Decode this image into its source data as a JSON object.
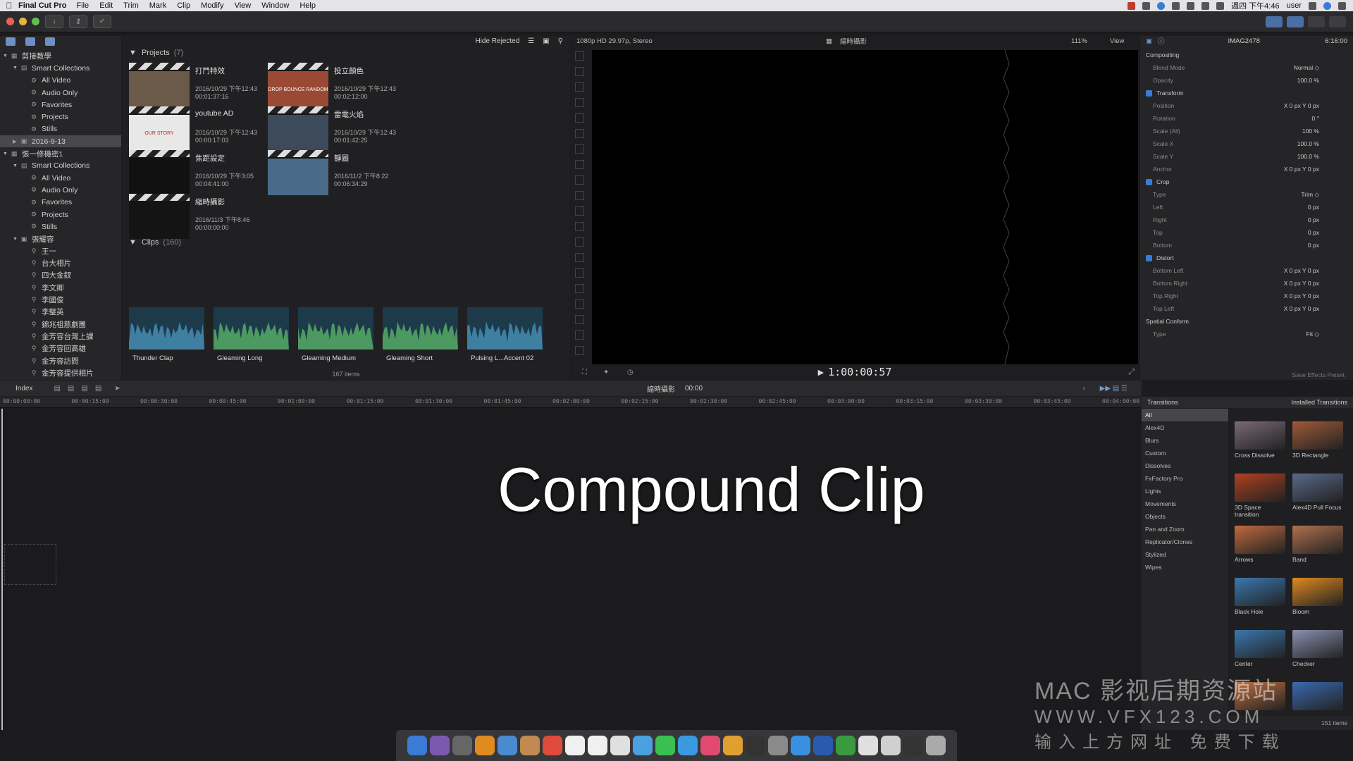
{
  "menubar": {
    "app_name": "Final Cut Pro",
    "items": [
      "File",
      "Edit",
      "Trim",
      "Mark",
      "Clip",
      "Modify",
      "View",
      "Window",
      "Help"
    ],
    "clock": "週四 下午4:46",
    "user": "user"
  },
  "library": {
    "rows": [
      {
        "label": "剪接教學",
        "indent": 0,
        "tri": "▼",
        "icon": "library-icon",
        "glyph": "▦"
      },
      {
        "label": "Smart Collections",
        "indent": 1,
        "tri": "▼",
        "icon": "folder-icon",
        "glyph": "▤"
      },
      {
        "label": "All Video",
        "indent": 2,
        "tri": "",
        "icon": "gear-icon",
        "glyph": "⚙"
      },
      {
        "label": "Audio Only",
        "indent": 2,
        "tri": "",
        "icon": "gear-icon",
        "glyph": "⚙"
      },
      {
        "label": "Favorites",
        "indent": 2,
        "tri": "",
        "icon": "gear-icon",
        "glyph": "⚙"
      },
      {
        "label": "Projects",
        "indent": 2,
        "tri": "",
        "icon": "gear-icon",
        "glyph": "⚙"
      },
      {
        "label": "Stills",
        "indent": 2,
        "tri": "",
        "icon": "gear-icon",
        "glyph": "⚙"
      },
      {
        "label": "2016-9-13",
        "indent": 1,
        "tri": "▶",
        "icon": "event-icon",
        "glyph": "▣",
        "selected": true
      },
      {
        "label": "張一修機密1",
        "indent": 0,
        "tri": "▼",
        "icon": "library-icon",
        "glyph": "▦"
      },
      {
        "label": "Smart Collections",
        "indent": 1,
        "tri": "▼",
        "icon": "folder-icon",
        "glyph": "▤"
      },
      {
        "label": "All Video",
        "indent": 2,
        "tri": "",
        "icon": "gear-icon",
        "glyph": "⚙"
      },
      {
        "label": "Audio Only",
        "indent": 2,
        "tri": "",
        "icon": "gear-icon",
        "glyph": "⚙"
      },
      {
        "label": "Favorites",
        "indent": 2,
        "tri": "",
        "icon": "gear-icon",
        "glyph": "⚙"
      },
      {
        "label": "Projects",
        "indent": 2,
        "tri": "",
        "icon": "gear-icon",
        "glyph": "⚙"
      },
      {
        "label": "Stills",
        "indent": 2,
        "tri": "",
        "icon": "gear-icon",
        "glyph": "⚙"
      },
      {
        "label": "張耀容",
        "indent": 1,
        "tri": "▼",
        "icon": "event-icon",
        "glyph": "▣"
      },
      {
        "label": "王一",
        "indent": 2,
        "tri": "",
        "icon": "keyword-icon",
        "glyph": "⚲"
      },
      {
        "label": "台大相片",
        "indent": 2,
        "tri": "",
        "icon": "keyword-icon",
        "glyph": "⚲"
      },
      {
        "label": "四大金釵",
        "indent": 2,
        "tri": "",
        "icon": "keyword-icon",
        "glyph": "⚲"
      },
      {
        "label": "李文卿",
        "indent": 2,
        "tri": "",
        "icon": "keyword-icon",
        "glyph": "⚲"
      },
      {
        "label": "李國俊",
        "indent": 2,
        "tri": "",
        "icon": "keyword-icon",
        "glyph": "⚲"
      },
      {
        "label": "李璧英",
        "indent": 2,
        "tri": "",
        "icon": "keyword-icon",
        "glyph": "⚲"
      },
      {
        "label": "錦兆祖慈劇團",
        "indent": 2,
        "tri": "",
        "icon": "keyword-icon",
        "glyph": "⚲"
      },
      {
        "label": "金芳容台灣上課",
        "indent": 2,
        "tri": "",
        "icon": "keyword-icon",
        "glyph": "⚲"
      },
      {
        "label": "金芳容回高雄",
        "indent": 2,
        "tri": "",
        "icon": "keyword-icon",
        "glyph": "⚲"
      },
      {
        "label": "金芳容訪問",
        "indent": 2,
        "tri": "",
        "icon": "keyword-icon",
        "glyph": "⚲"
      },
      {
        "label": "金芳容提供相片",
        "indent": 2,
        "tri": "",
        "icon": "keyword-icon",
        "glyph": "⚲"
      }
    ]
  },
  "browser": {
    "filter": "Hide Rejected",
    "projects_label": "Projects",
    "projects_count": "(7)",
    "projects": [
      {
        "name": "打鬥特效",
        "date": "2016/10/29 下午12:43",
        "duration": "00:01:37:16",
        "color": "#6b5a48"
      },
      {
        "name": "投立顏色",
        "date": "2016/10/29 下午12:43",
        "duration": "00:02:12:00",
        "color": "#9a4a34",
        "overlay": "DROP BOUNCE RANDOM"
      },
      {
        "name": "youtube AD",
        "date": "2016/10/29 下午12:43",
        "duration": "00:00:17:03",
        "color": "#e8e8e8",
        "overlay": "OUR STORY"
      },
      {
        "name": "雷電火焰",
        "date": "2016/10/29 下午12:43",
        "duration": "00:01:42:25",
        "color": "#3c4a5a"
      },
      {
        "name": "焦距設定",
        "date": "2016/10/29 下午3:05",
        "duration": "00:04:41:00",
        "color": "#111111"
      },
      {
        "name": "靜圖",
        "date": "2016/11/2 下午8:22",
        "duration": "00:06:34:29",
        "color": "#4a6a8a"
      },
      {
        "name": "縮時攝影",
        "date": "2016/11/3 下午8:46",
        "duration": "00:00:00:00",
        "color": "#141414"
      }
    ],
    "clips_label": "Clips",
    "clips_count": "(160)",
    "clips": [
      {
        "name": "Thunder Clap",
        "color": "#3f7fa2"
      },
      {
        "name": "Gleaming Long",
        "color": "#4c9a62"
      },
      {
        "name": "Gleaming Medium",
        "color": "#4c9a62"
      },
      {
        "name": "Gleaming Short",
        "color": "#4c9a62"
      },
      {
        "name": "Pulsing L...Accent 02",
        "color": "#3f7fa2"
      }
    ],
    "status": "167 items"
  },
  "viewer": {
    "format": "1080p HD 29.97p, Stereo",
    "title": "縮時攝影",
    "zoom": "111%",
    "view_label": "View",
    "timecode": "1:00:00:57"
  },
  "inspector": {
    "clip_name": "IMAG2478",
    "time": "6:16:00",
    "rows": [
      {
        "label": "Compositing",
        "value": "",
        "head": true
      },
      {
        "label": "Blend Mode",
        "value": "Normal ◇"
      },
      {
        "label": "Opacity",
        "value": "100.0 %"
      },
      {
        "label": "Transform",
        "value": "",
        "head": true,
        "check": true
      },
      {
        "label": "Position",
        "value": "X  0 px   Y  0 px"
      },
      {
        "label": "Rotation",
        "value": "0 °"
      },
      {
        "label": "Scale (All)",
        "value": "100 %"
      },
      {
        "label": "Scale X",
        "value": "100.0 %"
      },
      {
        "label": "Scale Y",
        "value": "100.0 %"
      },
      {
        "label": "Anchor",
        "value": "X  0 px   Y  0 px"
      },
      {
        "label": "Crop",
        "value": "",
        "head": true,
        "check": true
      },
      {
        "label": "Type",
        "value": "Trim ◇"
      },
      {
        "label": "Left",
        "value": "0 px"
      },
      {
        "label": "Right",
        "value": "0 px"
      },
      {
        "label": "Top",
        "value": "0 px"
      },
      {
        "label": "Bottom",
        "value": "0 px"
      },
      {
        "label": "Distort",
        "value": "",
        "head": true,
        "check": true
      },
      {
        "label": "Bottom Left",
        "value": "X  0 px   Y  0 px"
      },
      {
        "label": "Bottom Right",
        "value": "X  0 px   Y  0 px"
      },
      {
        "label": "Top Right",
        "value": "X  0 px   Y  0 px"
      },
      {
        "label": "Top Left",
        "value": "X  0 px   Y  0 px"
      },
      {
        "label": "Spatial Conform",
        "value": "",
        "head": true
      },
      {
        "label": "Type",
        "value": "Fit ◇"
      }
    ],
    "save_preset": "Save Effects Preset"
  },
  "timeline": {
    "index_label": "Index",
    "project_name": "縮時攝影",
    "project_time": "00:00",
    "ticks": [
      "00:00:00:00",
      "00:00:15:00",
      "00:00:30:00",
      "00:00:45:00",
      "00:01:00:00",
      "00:01:15:00",
      "00:01:30:00",
      "00:01:45:00",
      "00:02:00:00",
      "00:02:15:00",
      "00:02:30:00",
      "00:02:45:00",
      "00:03:00:00",
      "00:03:15:00",
      "00:03:30:00",
      "00:03:45:00",
      "00:04:00:00"
    ],
    "overlay_text": "Compound Clip"
  },
  "transitions": {
    "header": "Transitions",
    "installed": "Installed Transitions",
    "categories": [
      "All",
      "Alex4D",
      "Blurs",
      "Custom",
      "Dissolves",
      "FxFactory Pro",
      "Lights",
      "Movements",
      "Objects",
      "Pan and Zoom",
      "Replicator/Clones",
      "Stylized",
      "Wipes"
    ],
    "items": [
      {
        "name": "Cross Dissolve",
        "color": "#7a6a78"
      },
      {
        "name": "3D Rectangle",
        "color": "#a05a38"
      },
      {
        "name": "3D Space transition",
        "color": "#b04020"
      },
      {
        "name": "Alex4D Pull Focus",
        "color": "#5a6a8a"
      },
      {
        "name": "Arrows",
        "color": "#c06a40"
      },
      {
        "name": "Band",
        "color": "#b07050"
      },
      {
        "name": "Black Hole",
        "color": "#3a78b0"
      },
      {
        "name": "Bloom",
        "color": "#e08a20"
      },
      {
        "name": "Center",
        "color": "#3a78b0"
      },
      {
        "name": "Checker",
        "color": "#8a90b0"
      },
      {
        "name": "",
        "color": "#c07040"
      },
      {
        "name": "",
        "color": "#3a6ab0"
      }
    ],
    "status": "151 items"
  },
  "watermark": {
    "line1": "MAC 影视后期资源站",
    "line2": "WWW.VFX123.COM",
    "line3": "输入上方网址 免费下载"
  },
  "dock_colors": [
    "#3a7bd5",
    "#7a5ab0",
    "#666666",
    "#e08a20",
    "#4a8ad0",
    "#c08a50",
    "#e04a3a",
    "#f0f0f0",
    "#f0f0f0",
    "#e0e0e0",
    "#4aa0e0",
    "#3ac050",
    "#3a9ae0",
    "#e04a70",
    "#e0a030",
    "#333333",
    "#8a8a8a",
    "#3a90e0",
    "#2a5ab0",
    "#3a9a40",
    "#e0e0e0",
    "#d0d0d0",
    "#333333",
    "#aaaaaa"
  ]
}
